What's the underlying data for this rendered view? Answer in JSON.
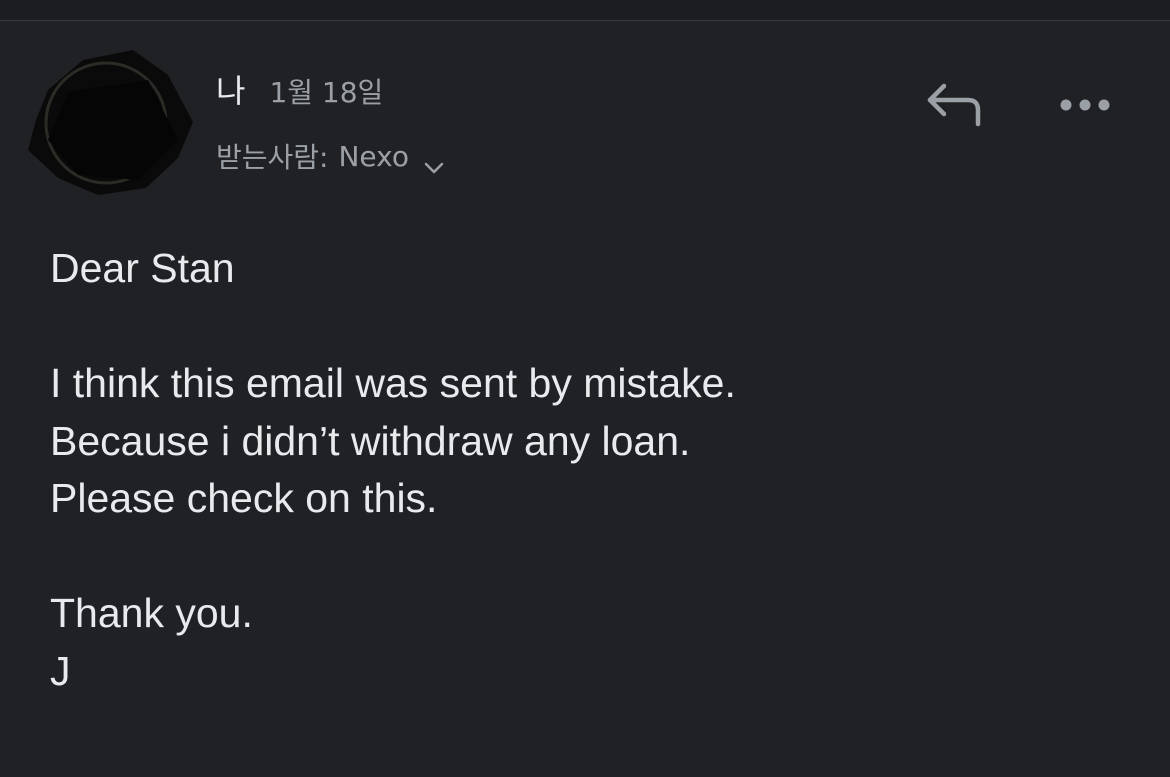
{
  "header": {
    "sender_name": "나",
    "date": "1월 18일",
    "recipient_label": "받는사람:",
    "recipient_name": "Nexo"
  },
  "actions": {
    "reply_icon": "reply-arrow-icon",
    "more_icon": "more-horizontal-icon",
    "expand_icon": "chevron-down-icon"
  },
  "message": {
    "greeting": "Dear Stan",
    "lines": [
      "I think this email was sent by mistake.",
      "Because i didn’t withdraw any loan.",
      "Please check on this."
    ],
    "closing": "Thank you.",
    "signature": "J"
  },
  "colors": {
    "background": "#202124",
    "primary_text": "#e8eaed",
    "secondary_text": "#9aa0a6",
    "icon": "#9aa0a6"
  }
}
